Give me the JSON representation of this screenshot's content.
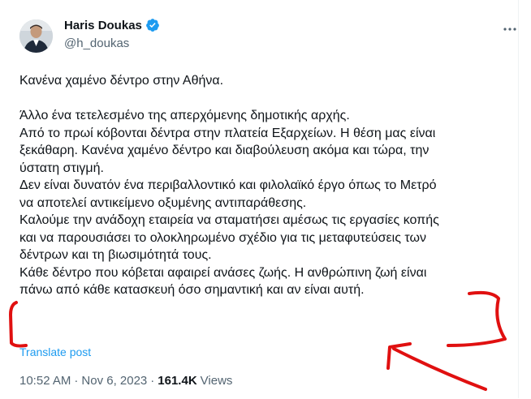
{
  "author": {
    "display_name": "Haris Doukas",
    "handle": "@h_doukas",
    "verified": true
  },
  "tweet": {
    "lines": [
      "Κανένα χαμένο δέντρο στην Αθήνα.",
      "",
      "Άλλο ένα τετελεσμένο της απερχόμενης δημοτικής αρχής.",
      "Από το πρωί κόβονται δέντρα στην πλατεία Εξαρχείων. Η θέση μας είναι",
      "ξεκάθαρη. Κανένα χαμένο δέντρο και διαβούλευση ακόμα και τώρα, την",
      "ύστατη στιγμή.",
      "Δεν είναι δυνατόν ένα περιβαλλοντικό και φιλολαϊκό έργο όπως το Μετρό",
      "να αποτελεί αντικείμενο οξυμένης αντιπαράθεσης.",
      "Καλούμε την ανάδοχη εταιρεία να σταματήσει αμέσως τις εργασίες κοπής",
      "και να παρουσιάσει το ολοκληρωμένο σχέδιο για τις μεταφυτεύσεις των",
      "δέντρων και τη βιωσιμότητά τους.",
      "Κάθε δέντρο που κόβεται αφαιρεί ανάσες ζωής. Η ανθρώπινη ζωή είναι",
      "πάνω από κάθε κατασκευή όσο σημαντική και αν είναι αυτή."
    ],
    "translate_label": "Translate post"
  },
  "meta": {
    "time": "10:52 AM",
    "separator1": "·",
    "date": "Nov 6, 2023",
    "separator2": "·",
    "views_count": "161.4K",
    "views_label": "Views"
  },
  "icons": {
    "more": "more-options-icon",
    "verified": "verified-badge-icon"
  },
  "colors": {
    "text": "#0f1419",
    "secondary": "#536471",
    "link": "#1d9bf0",
    "verified": "#1d9bf0",
    "annotation": "#e01010"
  }
}
